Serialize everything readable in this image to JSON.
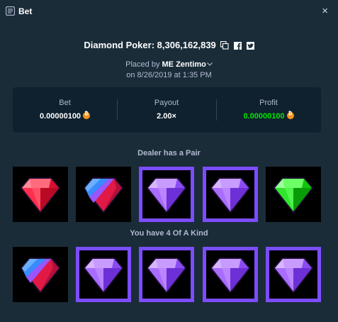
{
  "header": {
    "title": "Bet",
    "close_label": "×"
  },
  "bet": {
    "title_text": "Diamond Poker: 8,306,162,839",
    "placed_prefix": "Placed by",
    "username": "ME Zentimo",
    "date_line": "on 8/26/2019 at 1:35 PM"
  },
  "stats": {
    "bet_label": "Bet",
    "bet_value": "0.00000100",
    "payout_label": "Payout",
    "payout_value": "2.00×",
    "profit_label": "Profit",
    "profit_value": "0.00000100"
  },
  "dealer": {
    "label": "Dealer has a Pair",
    "cards": [
      {
        "gem": "red-gem",
        "highlight": false
      },
      {
        "gem": "blue-red-gem",
        "highlight": false
      },
      {
        "gem": "purple-gem",
        "highlight": true
      },
      {
        "gem": "purple-gem",
        "highlight": true
      },
      {
        "gem": "green-gem",
        "highlight": false
      }
    ]
  },
  "player": {
    "label": "You have 4 Of A Kind",
    "cards": [
      {
        "gem": "blue-red-gem",
        "highlight": false
      },
      {
        "gem": "purple-gem",
        "highlight": true
      },
      {
        "gem": "purple-gem",
        "highlight": true
      },
      {
        "gem": "purple-gem",
        "highlight": true
      },
      {
        "gem": "purple-gem",
        "highlight": true
      }
    ]
  },
  "colors": {
    "background": "#1a2c38",
    "panel": "#0f212e",
    "highlight": "#7c4dff",
    "profit": "#00e701",
    "coin": "#f7931a"
  }
}
